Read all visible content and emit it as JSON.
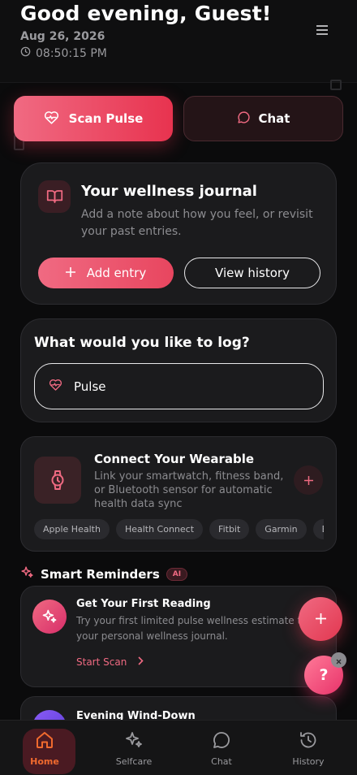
{
  "header": {
    "greeting": "Good evening, Guest!",
    "date": "Aug 26, 2026",
    "time": "08:50:15 PM",
    "icons": {
      "clock": "clock-icon",
      "menu": "menu-icon"
    }
  },
  "actions": {
    "scan_label": "Scan Pulse",
    "chat_label": "Chat"
  },
  "journal": {
    "title": "Your wellness journal",
    "description": "Add a note about how you feel, or revisit your past entries.",
    "add_label": "Add entry",
    "history_label": "View history"
  },
  "log": {
    "title": "What would you like to log?",
    "selected": "Pulse"
  },
  "wearable": {
    "title": "Connect Your Wearable",
    "description": "Link your smartwatch, fitness band, or Bluetooth sensor for automatic health data sync",
    "chips": [
      "Apple Health",
      "Health Connect",
      "Fitbit",
      "Garmin",
      "Blue"
    ]
  },
  "reminders": {
    "title": "Smart Reminders",
    "badge": "AI",
    "items": [
      {
        "title": "Get Your First Reading",
        "description": "Try your first limited pulse wellness estimate to s your personal wellness journal.",
        "cta": "Start Scan"
      },
      {
        "title": "Evening Wind-Down"
      }
    ]
  },
  "fab": {
    "help_label": "?"
  },
  "nav": {
    "items": [
      {
        "label": "Home",
        "icon": "home-icon"
      },
      {
        "label": "Selfcare",
        "icon": "sparkles-icon"
      },
      {
        "label": "Chat",
        "icon": "chat-bubble-icon"
      },
      {
        "label": "History",
        "icon": "history-icon"
      }
    ],
    "active": "Home"
  },
  "colors": {
    "accent": "#f06a82",
    "accent_deep": "#e8334f",
    "background": "#0b0b0c",
    "card": "#1b1b1d",
    "nav_active": "#f06a2e"
  }
}
